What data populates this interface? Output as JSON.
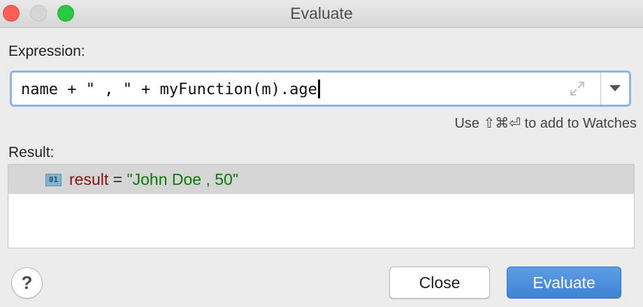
{
  "window": {
    "title": "Evaluate"
  },
  "expression": {
    "label": "Expression:",
    "value": "name + \" , \" + myFunction(m).age"
  },
  "hint": "Use ⇧⌘⏎ to add to Watches",
  "result": {
    "label": "Result:",
    "badge": "01",
    "name": "result",
    "equals": " = ",
    "value": "\"John Doe , 50\""
  },
  "buttons": {
    "help": "?",
    "close": "Close",
    "evaluate": "Evaluate"
  },
  "colors": {
    "accent": "#4a8ddc",
    "focus_ring": "#8db5e6",
    "result_name": "#871111",
    "result_value": "#0b7a0b",
    "selected_row": "#d5d5d5"
  },
  "icons": [
    "expand-icon",
    "chevron-down-icon",
    "primitive-type-icon",
    "help-icon"
  ]
}
